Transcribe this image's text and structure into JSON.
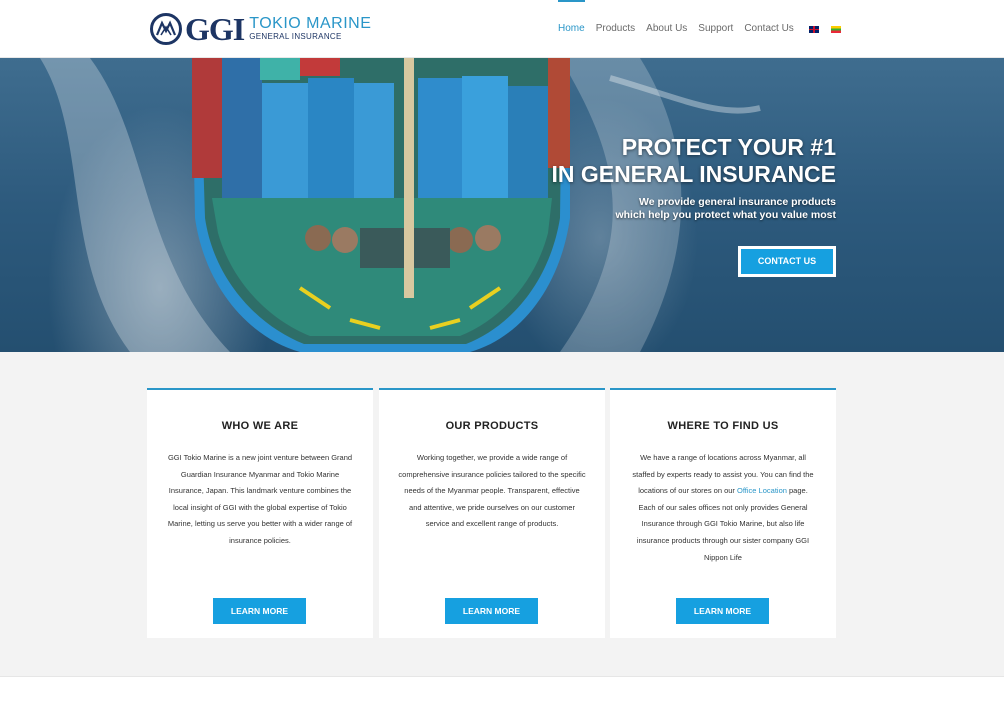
{
  "header": {
    "logo_main": "GGI",
    "logo_line1": "TOKIO MARINE",
    "logo_line2": "GENERAL INSURANCE",
    "nav": [
      {
        "label": "Home",
        "active": true
      },
      {
        "label": "Products",
        "active": false
      },
      {
        "label": "About Us",
        "active": false
      },
      {
        "label": "Support",
        "active": false
      },
      {
        "label": "Contact Us",
        "active": false
      }
    ],
    "languages": [
      "english-flag-icon",
      "myanmar-flag-icon"
    ]
  },
  "hero": {
    "title_line1": "PROTECT YOUR #1",
    "title_line2": "IN GENERAL INSURANCE",
    "sub_line1": "We provide general insurance products",
    "sub_line2": "which help you protect what you value most",
    "button": "CONTACT US"
  },
  "cards": [
    {
      "title": "WHO WE ARE",
      "body": "GGI Tokio Marine is a new joint venture between Grand Guardian Insurance Myanmar and Tokio Marine Insurance, Japan. This landmark venture combines the local insight of GGI with the global expertise of Tokio Marine, letting us serve you better with a wider range of insurance policies.",
      "button": "LEARN MORE"
    },
    {
      "title": "OUR PRODUCTS",
      "body": "Working together, we provide a wide range of comprehensive insurance policies tailored to the specific needs of the Myanmar people. Transparent, effective and attentive, we pride ourselves on our customer service and excellent range of products.",
      "button": "LEARN MORE"
    },
    {
      "title": "WHERE TO FIND US",
      "body_before_link": "We have a range of locations across Myanmar, all staffed by experts ready to assist you. You can find the locations of our stores on our ",
      "link": "Office Location",
      "body_after_link": " page. Each of our sales offices not only provides General Insurance through GGI Tokio Marine, but also life insurance products through our sister company GGI Nippon Life",
      "button": "LEARN MORE"
    }
  ],
  "colors": {
    "accent": "#16a0e0",
    "brand_navy": "#1d3564",
    "brand_blue": "#2a96c8"
  }
}
